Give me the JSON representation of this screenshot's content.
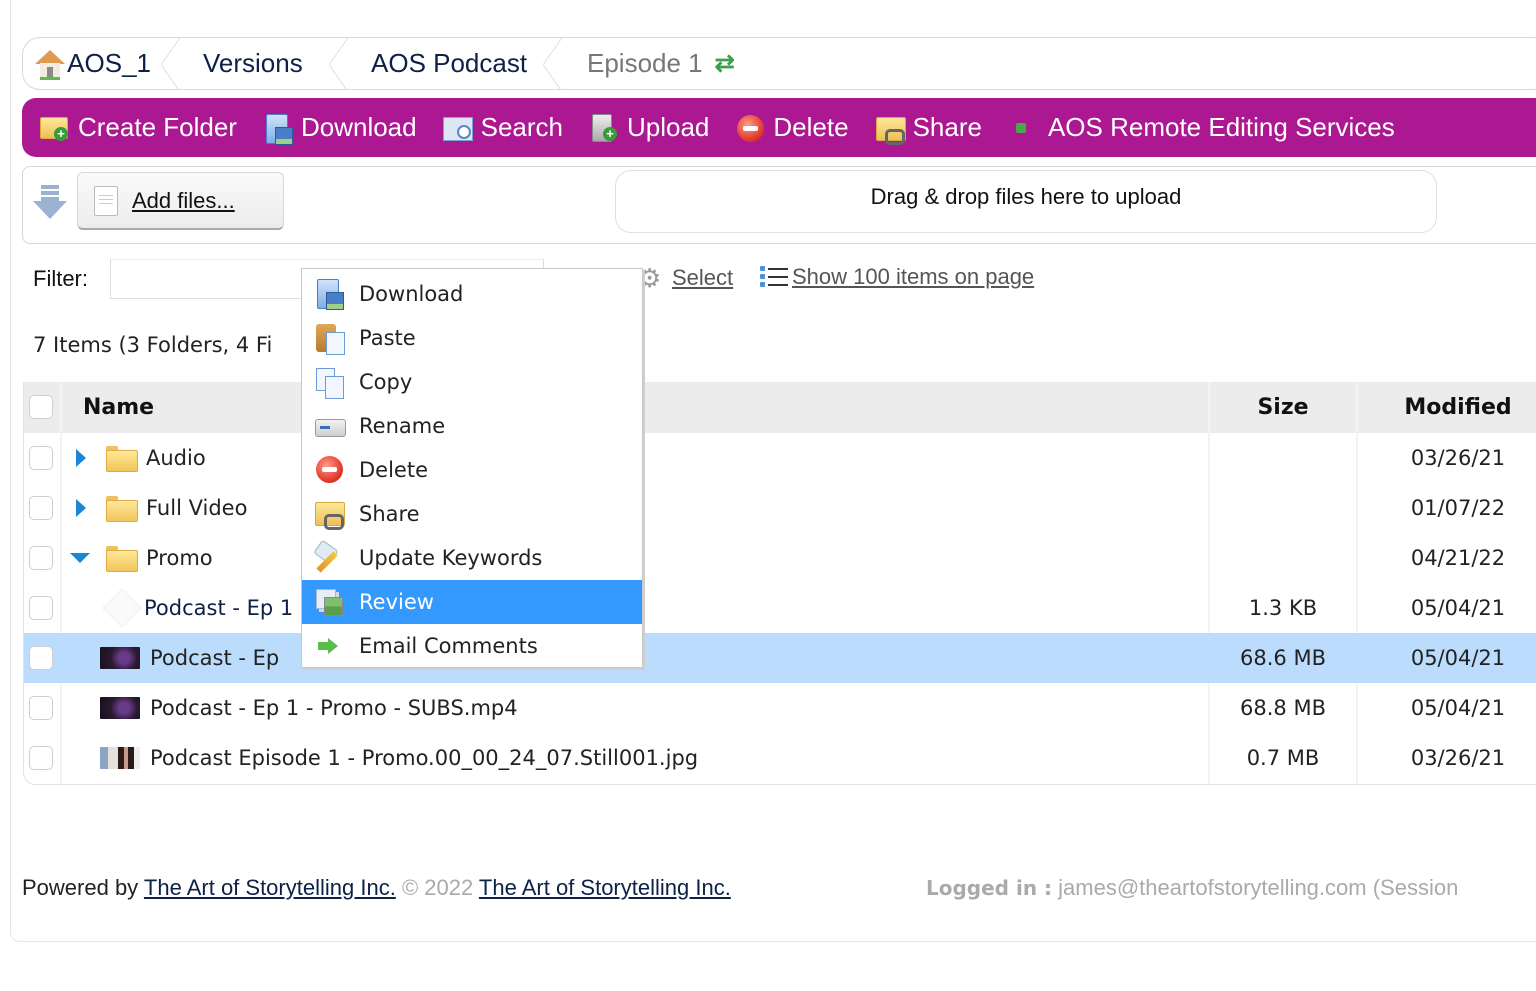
{
  "breadcrumb": {
    "items": [
      {
        "label": "AOS_1",
        "icon": "home-icon"
      },
      {
        "label": "Versions"
      },
      {
        "label": "AOS Podcast"
      },
      {
        "label": "Episode 1",
        "icon": "refresh-icon",
        "current": true
      }
    ]
  },
  "toolbar": {
    "background": "#ac1892",
    "items": [
      {
        "label": "Create Folder",
        "icon": "folder-add-icon"
      },
      {
        "label": "Download",
        "icon": "download-icon"
      },
      {
        "label": "Search",
        "icon": "search-icon"
      },
      {
        "label": "Upload",
        "icon": "upload-icon"
      },
      {
        "label": "Delete",
        "icon": "delete-icon"
      },
      {
        "label": "Share",
        "icon": "share-icon"
      },
      {
        "label": "AOS Remote Editing Services",
        "icon": "status-dot-icon"
      }
    ]
  },
  "upload": {
    "add_files_label": "Add files...",
    "dropzone_text": "Drag & drop files here to upload"
  },
  "filter": {
    "label": "Filter:",
    "value": "",
    "placeholder": ""
  },
  "actions": {
    "select_label": "Select",
    "show_items_label": "Show 100 items on page"
  },
  "summary": "7 Items (3 Folders, 4 Fi",
  "table": {
    "columns": {
      "name": "Name",
      "size": "Size",
      "modified": "Modified"
    },
    "rows": [
      {
        "type": "folder",
        "name": "Audio",
        "expanded": false,
        "size": "",
        "modified": "03/26/21"
      },
      {
        "type": "folder",
        "name": "Full Video",
        "expanded": false,
        "size": "",
        "modified": "01/07/22"
      },
      {
        "type": "folder",
        "name": "Promo",
        "expanded": true,
        "size": "",
        "modified": "04/21/22"
      },
      {
        "type": "file",
        "thumb": "blank",
        "name": "Podcast - Ep 1",
        "size": "1.3 KB",
        "modified": "05/04/21"
      },
      {
        "type": "file",
        "thumb": "video",
        "name": "Podcast - Ep ",
        "size": "68.6 MB",
        "modified": "05/04/21",
        "selected": true
      },
      {
        "type": "file",
        "thumb": "video",
        "name": "Podcast - Ep 1 - Promo - SUBS.mp4",
        "size": "68.8 MB",
        "modified": "05/04/21"
      },
      {
        "type": "file",
        "thumb": "photo",
        "name": "Podcast Episode 1 - Promo.00_00_24_07.Still001.jpg",
        "size": "0.7 MB",
        "modified": "03/26/21"
      }
    ]
  },
  "context_menu": {
    "highlight_color": "#3399ff",
    "items": [
      {
        "label": "Download",
        "icon": "download-icon"
      },
      {
        "label": "Paste",
        "icon": "paste-icon"
      },
      {
        "label": "Copy",
        "icon": "copy-icon"
      },
      {
        "label": "Rename",
        "icon": "rename-icon"
      },
      {
        "label": "Delete",
        "icon": "delete-icon"
      },
      {
        "label": "Share",
        "icon": "share-icon"
      },
      {
        "label": "Update Keywords",
        "icon": "keywords-icon"
      },
      {
        "label": "Review",
        "icon": "review-icon",
        "highlighted": true
      },
      {
        "label": "Email Comments",
        "icon": "arrow-right-icon"
      }
    ]
  },
  "footer": {
    "powered_by": "Powered by",
    "company_link_1": "The Art of Storytelling Inc.",
    "copyright": "© 2022",
    "company_link_2": "The Art of Storytelling Inc.",
    "logged_in_label": "Logged in :",
    "logged_in_value": "james@theartofstorytelling.com (Session"
  }
}
